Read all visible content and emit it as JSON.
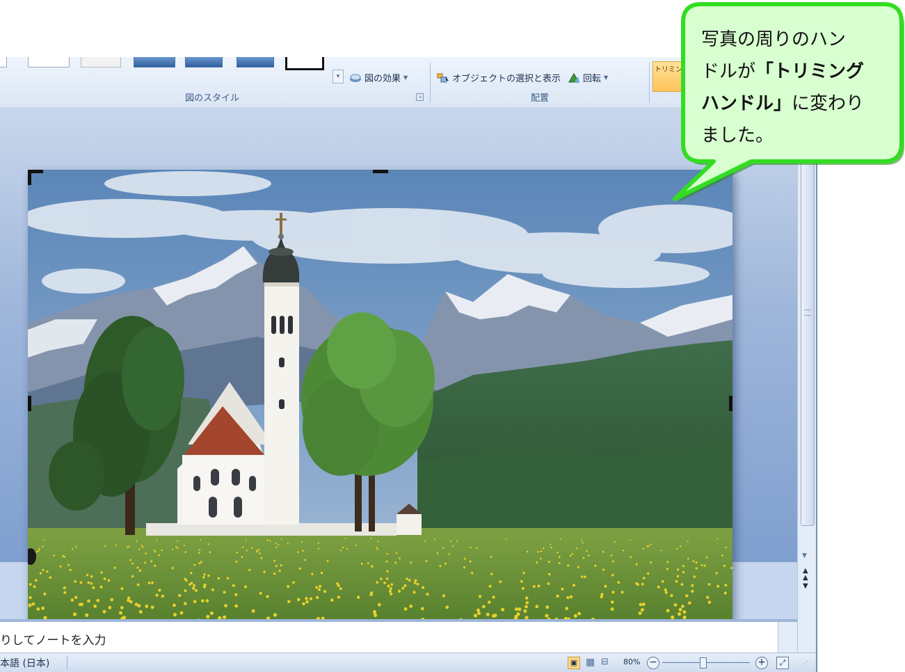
{
  "ribbon": {
    "picture_effects_label": "図の効果",
    "picture_styles_group_label": "図のスタイル",
    "selection_pane_label": "オブジェクトの選択と表示",
    "rotate_label": "回転",
    "arrange_group_label": "配置",
    "crop_label": "トリミン"
  },
  "notes": {
    "placeholder": "りしてノートを入力"
  },
  "statusbar": {
    "language": "本語 (日本)",
    "zoom": "80%"
  },
  "callout": {
    "line1": "写真の周りのハン",
    "line2_prefix": "ドルが",
    "line2_bold": "「トリミング",
    "line3_bold": "ハンドル」",
    "line3_suffix": "に変わり",
    "line4": "ました。"
  },
  "colors": {
    "callout_fill": "#d8ffd0",
    "callout_border": "#33dd22",
    "ribbon_bg": "#dbe6f5",
    "accent": "#2e5f9e"
  }
}
